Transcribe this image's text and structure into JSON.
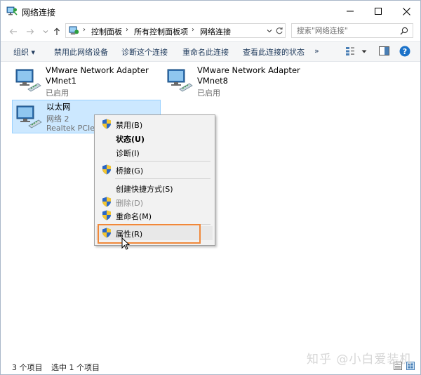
{
  "window": {
    "title": "网络连接",
    "controls": [
      "minimize",
      "maximize",
      "close"
    ]
  },
  "address": {
    "breadcrumbs": [
      "控制面板",
      "所有控制面板项",
      "网络连接"
    ],
    "search_placeholder": "搜索\"网络连接\""
  },
  "commands": {
    "organize": "组织 ▾",
    "disable": "禁用此网络设备",
    "diagnose": "诊断这个连接",
    "rename": "重命名此连接",
    "status": "查看此连接的状态",
    "more": "»"
  },
  "adapters": [
    {
      "name1": "VMware Network Adapter",
      "name2": "VMnet1",
      "status": "已启用"
    },
    {
      "name1": "VMware Network Adapter",
      "name2": "VMnet8",
      "status": "已启用"
    },
    {
      "name1": "以太网",
      "network": "网络 2",
      "device": "Realtek PCIe G"
    }
  ],
  "context_menu": {
    "items": [
      {
        "label": "禁用(B)",
        "shield": true,
        "style": "normal"
      },
      {
        "label": "状态(U)",
        "shield": false,
        "style": "bold"
      },
      {
        "label": "诊断(I)",
        "shield": false,
        "style": "normal"
      },
      {
        "label": "桥接(G)",
        "shield": true,
        "style": "normal"
      },
      {
        "label": "创建快捷方式(S)",
        "shield": false,
        "style": "normal"
      },
      {
        "label": "删除(D)",
        "shield": true,
        "style": "disabled"
      },
      {
        "label": "重命名(M)",
        "shield": true,
        "style": "normal"
      },
      {
        "label": "属性(R)",
        "shield": true,
        "style": "hover"
      }
    ]
  },
  "statusbar": {
    "count": "3 个项目",
    "selected": "选中 1 个项目"
  },
  "watermark": "知乎 @小白爱装机",
  "colors": {
    "selection_bg": "#cce8ff",
    "highlight_border": "#f0883a",
    "help_blue": "#1b72c9"
  }
}
